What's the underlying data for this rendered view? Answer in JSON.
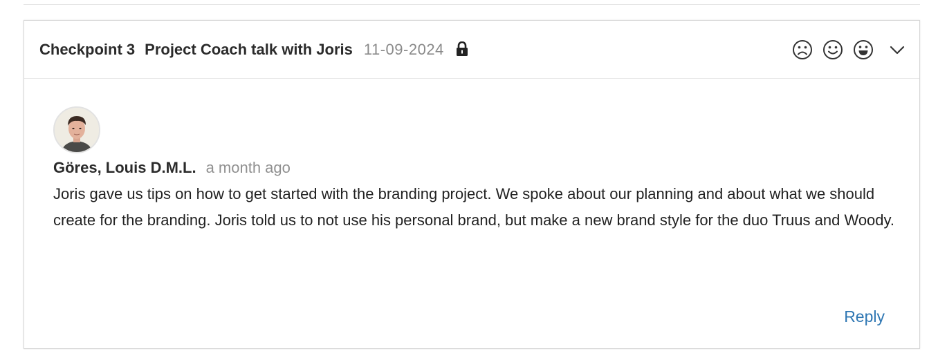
{
  "checkpoint": {
    "label": "Checkpoint 3",
    "title": "Project Coach talk with Joris",
    "date": "11-09-2024",
    "lock_icon": "lock-icon",
    "mood_icons": [
      "sad-face-icon",
      "smile-face-icon",
      "happy-face-icon"
    ],
    "toggle_icon": "chevron-down-icon"
  },
  "comment": {
    "author": "Göres, Louis D.M.L.",
    "time": "a month ago",
    "avatar_icon": "user-avatar",
    "text": "Joris gave us tips on how to get started with the branding project. We spoke about our planning and about what we should create for the branding. Joris told us to not use his personal brand, but make a new brand style for the duo Truus and Woody.",
    "reply_label": "Reply"
  },
  "colors": {
    "link": "#2f77b3",
    "muted_text": "#8a8a8a",
    "border": "#d6d6d6"
  }
}
